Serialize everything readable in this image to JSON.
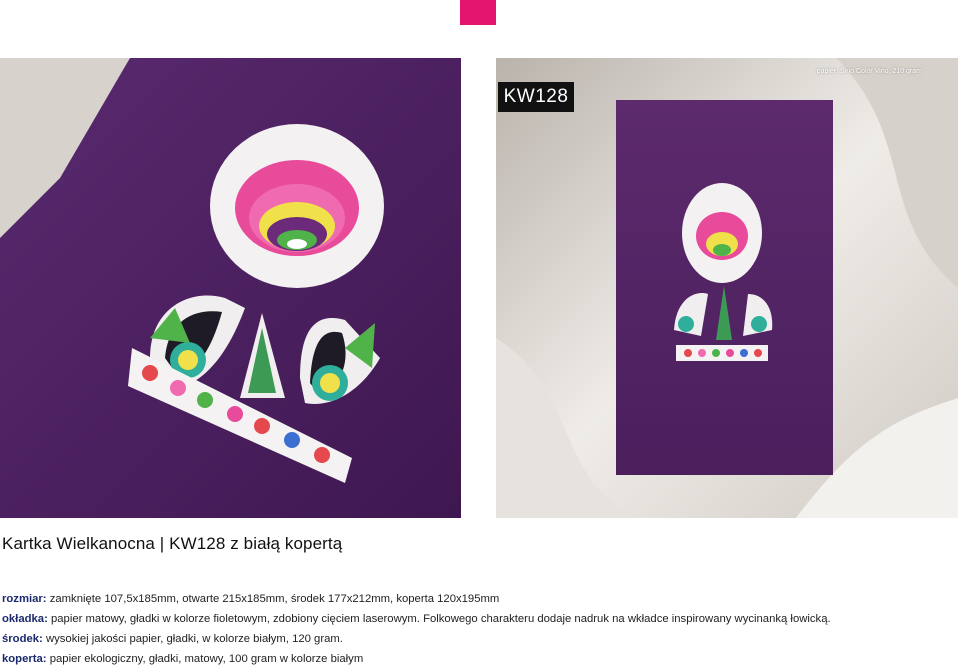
{
  "header": {
    "accent_color": "#e4156f"
  },
  "photos": {
    "left": {
      "subject": "close-up of purple card with laser-cut folk flower and roosters"
    },
    "right": {
      "badge": "KW128",
      "paper_note": "papier: Sirio Color Vino, 210 gram"
    }
  },
  "product": {
    "title": "Kartka Wielkanocna | KW128 z białą kopertą"
  },
  "specs": [
    {
      "key": "rozmiar:",
      "value": " zamknięte 107,5x185mm, otwarte 215x185mm, środek 177x212mm, koperta 120x195mm"
    },
    {
      "key": "okładka:",
      "value": " papier matowy, gładki w kolorze fioletowym, zdobiony cięciem laserowym. Folkowego charakteru dodaje nadruk na wkładce inspirowany wycinanką łowicką."
    },
    {
      "key": "środek:",
      "value": " wysokiej jakości papier, gładki, w kolorze białym, 120 gram."
    },
    {
      "key": "koperta:",
      "value": " papier ekologiczny, gładki, matowy, 100 gram w kolorze białym"
    }
  ],
  "colors": {
    "card_purple": "#4f2161",
    "spec_key": "#1a2a6c"
  }
}
